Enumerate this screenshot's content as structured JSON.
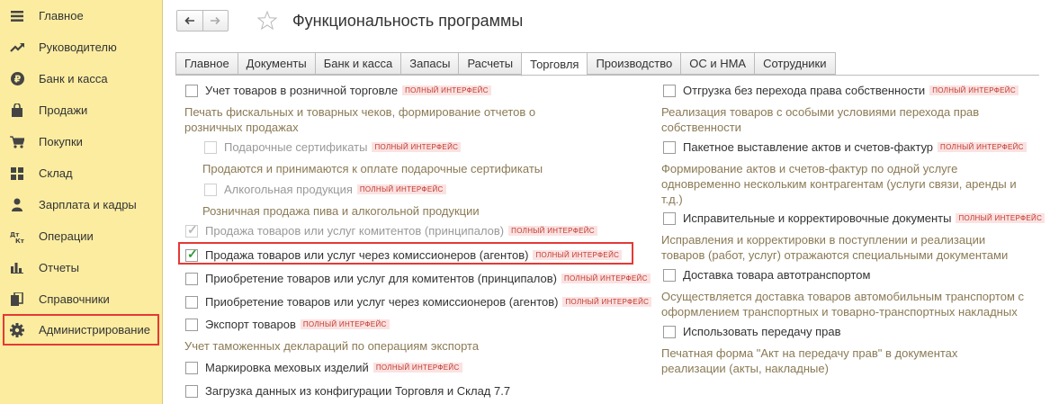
{
  "sidebar": {
    "items": [
      {
        "label": "Главное",
        "icon": "menu-icon"
      },
      {
        "label": "Руководителю",
        "icon": "trend-icon"
      },
      {
        "label": "Банк и касса",
        "icon": "ruble-icon"
      },
      {
        "label": "Продажи",
        "icon": "bag-icon"
      },
      {
        "label": "Покупки",
        "icon": "cart-icon"
      },
      {
        "label": "Склад",
        "icon": "warehouse-icon"
      },
      {
        "label": "Зарплата и кадры",
        "icon": "person-icon"
      },
      {
        "label": "Операции",
        "icon": "dt-kt-icon"
      },
      {
        "label": "Отчеты",
        "icon": "bar-chart-icon"
      },
      {
        "label": "Справочники",
        "icon": "books-icon"
      },
      {
        "label": "Администрирование",
        "icon": "gear-icon"
      }
    ]
  },
  "header": {
    "title": "Функциональность программы",
    "back_icon": "arrow-left-icon",
    "forward_icon": "arrow-right-icon",
    "favorite_icon": "star-icon"
  },
  "tabs": [
    "Главное",
    "Документы",
    "Банк и касса",
    "Запасы",
    "Расчеты",
    "Торговля",
    "Производство",
    "ОС и НМА",
    "Сотрудники"
  ],
  "active_tab": "Торговля",
  "badge_text": "ПОЛНЫЙ ИНТЕРФЕЙС",
  "left": {
    "retail": {
      "label": "Учет товаров в розничной торговле",
      "desc1": "Печать фискальных и товарных чеков, формирование отчетов о",
      "desc2": "розничных продажах"
    },
    "gift": {
      "label": "Подарочные сертификаты",
      "desc": "Продаются и принимаются к оплате подарочные сертификаты"
    },
    "alcohol": {
      "label": "Алкогольная продукция",
      "desc": "Розничная продажа пива и алкогольной продукции"
    },
    "principals": {
      "label": "Продажа товаров или услуг комитентов (принципалов)"
    },
    "agents_sale": {
      "label": "Продажа товаров или услуг через комиссионеров (агентов)"
    },
    "buy_principals": {
      "label": "Приобретение товаров или услуг для комитентов (принципалов)"
    },
    "buy_agents": {
      "label": "Приобретение товаров или услуг через комиссионеров (агентов)"
    },
    "export": {
      "label": "Экспорт товаров",
      "desc": "Учет таможенных деклараций по операциям экспорта"
    },
    "fur": {
      "label": "Маркировка меховых изделий"
    },
    "load77": {
      "label": "Загрузка данных из конфигурации Торговля и Склад 7.7"
    }
  },
  "right": {
    "ownership": {
      "label": "Отгрузка без перехода права собственности",
      "desc1": "Реализация товаров с особыми условиями перехода прав",
      "desc2": "собственности"
    },
    "batch_acts": {
      "label": "Пакетное выставление актов и счетов-фактур",
      "desc1": "Формирование актов и счетов-фактур по одной услуге",
      "desc2": "одновременно нескольким контрагентам (услуги связи, аренды и",
      "desc3": "т.д.)"
    },
    "corrections": {
      "label": "Исправительные и корректировочные документы",
      "desc1": "Исправления и корректировки в поступлении и реализации",
      "desc2": "товаров (работ, услуг) отражаются специальными документами"
    },
    "delivery": {
      "label": "Доставка товара автотранспортом",
      "desc1": "Осуществляется доставка товаров автомобильным транспортом с",
      "desc2": "оформлением транспортных и товарно-транспортных накладных"
    },
    "rights": {
      "label": "Использовать передачу прав",
      "desc1": "Печатная форма \"Акт на передачу прав\" в документах",
      "desc2": "реализации (акты, накладные)"
    }
  },
  "colors": {
    "sidebar_bg": "#fbeca0",
    "highlight": "#e53935",
    "badge_text": "#c0392b",
    "badge_bg": "#fbe2e2",
    "desc": "#8a7a55",
    "check": "#2e9b3a"
  }
}
